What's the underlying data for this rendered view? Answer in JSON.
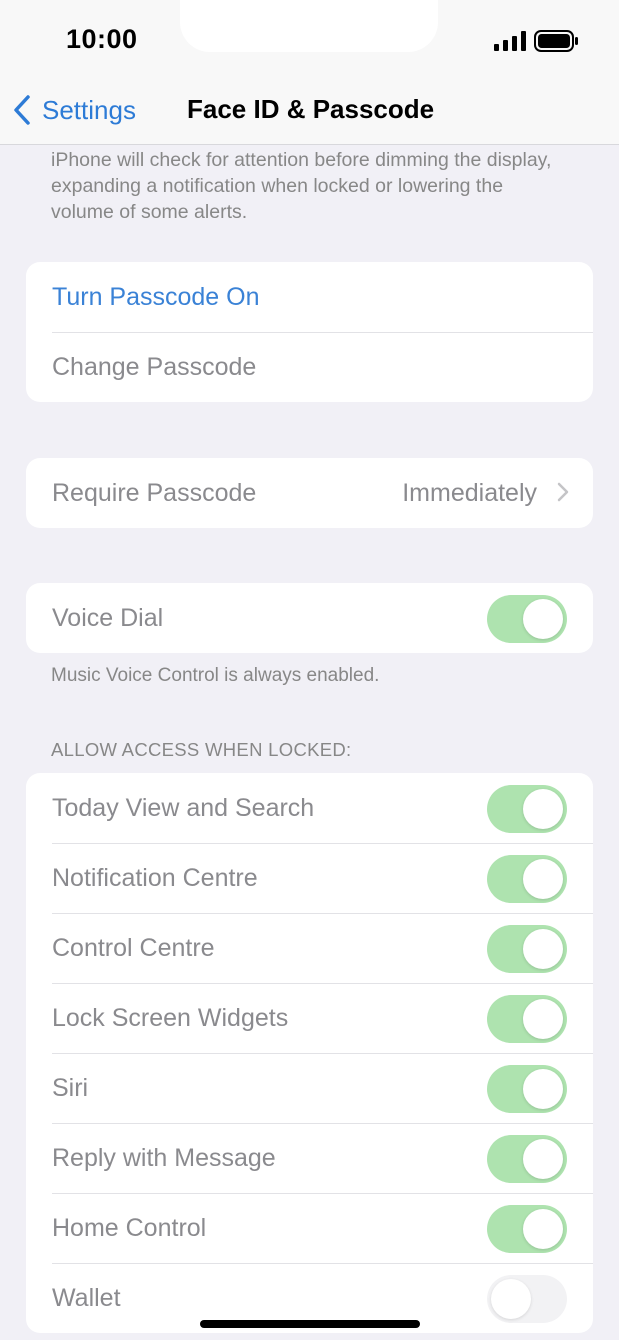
{
  "status_bar": {
    "time": "10:00",
    "signal_icon": "cellular-signal-icon",
    "battery_icon": "battery-full-icon"
  },
  "nav": {
    "back_label": "Settings",
    "title": "Face ID & Passcode"
  },
  "attention_note": "iPhone will check for attention before dimming the display, expanding a notification when locked or lowering the volume of some alerts.",
  "passcode_group": {
    "turn_on": "Turn Passcode On",
    "change": "Change Passcode"
  },
  "require_passcode": {
    "label": "Require Passcode",
    "value": "Immediately"
  },
  "voice_dial": {
    "label": "Voice Dial",
    "on": true,
    "footnote": "Music Voice Control is always enabled."
  },
  "allow_access": {
    "header": "ALLOW ACCESS WHEN LOCKED:",
    "items": [
      {
        "label": "Today View and Search",
        "on": true
      },
      {
        "label": "Notification Centre",
        "on": true
      },
      {
        "label": "Control Centre",
        "on": true
      },
      {
        "label": "Lock Screen Widgets",
        "on": true
      },
      {
        "label": "Siri",
        "on": true
      },
      {
        "label": "Reply with Message",
        "on": true
      },
      {
        "label": "Home Control",
        "on": true
      },
      {
        "label": "Wallet",
        "on": false
      }
    ]
  },
  "colors": {
    "accent": "#3a82d6",
    "toggle_on": "#aee3af",
    "background": "#f1f0f6"
  }
}
